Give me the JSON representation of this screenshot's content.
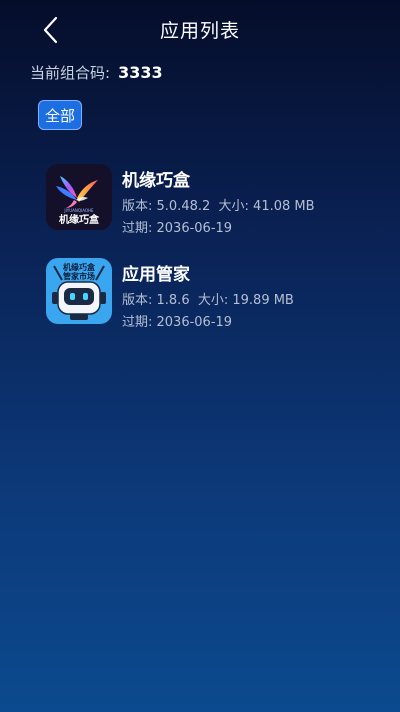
{
  "header": {
    "back_icon": "chevron-left-icon",
    "title": "应用列表"
  },
  "group": {
    "label": "当前组合码:",
    "code": "3333"
  },
  "filter": {
    "all_label": "全部"
  },
  "apps": [
    {
      "name": "机缘巧盒",
      "version_label": "版本: 5.0.48.2",
      "size_label": "大小: 41.08 MB",
      "expiry_label": "过期: 2036-06-19",
      "icon": "bird-logo-icon",
      "icon_text": "机缘巧盒"
    },
    {
      "name": "应用管家",
      "version_label": "版本: 1.8.6",
      "size_label": "大小: 19.89 MB",
      "expiry_label": "过期: 2036-06-19",
      "icon": "robot-logo-icon",
      "icon_text_line1": "机缘巧盒",
      "icon_text_line2": "管家市场"
    }
  ],
  "colors": {
    "accent": "#1d6ee0",
    "background_top": "#050d2a",
    "background_bottom": "#0b4a8e"
  }
}
